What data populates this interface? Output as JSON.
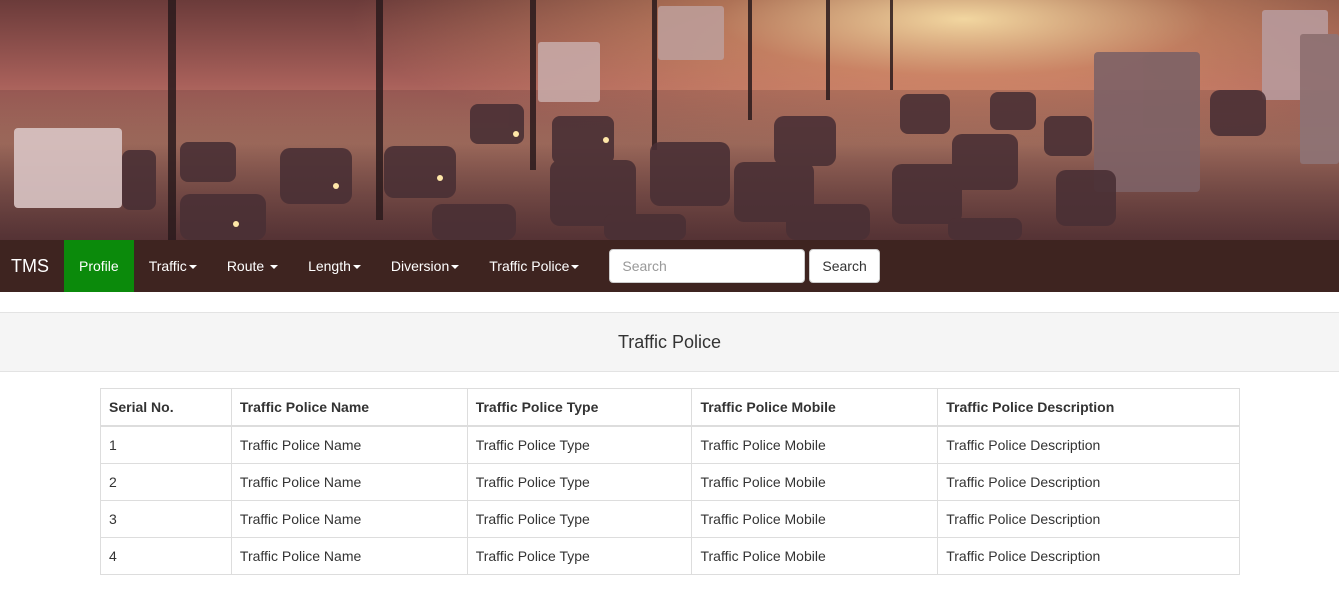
{
  "navbar": {
    "brand": "TMS",
    "items": [
      {
        "label": "Profile",
        "active": true,
        "dropdown": false
      },
      {
        "label": "Traffic",
        "active": false,
        "dropdown": true
      },
      {
        "label": "Route ",
        "active": false,
        "dropdown": true
      },
      {
        "label": "Length",
        "active": false,
        "dropdown": true
      },
      {
        "label": "Diversion",
        "active": false,
        "dropdown": true
      },
      {
        "label": "Traffic Police",
        "active": false,
        "dropdown": true
      }
    ],
    "search": {
      "placeholder": "Search",
      "value": "",
      "button_label": "Search"
    },
    "colors": {
      "navbar_bg": "#3e2420",
      "active_bg": "#0b8a0b"
    }
  },
  "panel": {
    "title": "Traffic Police"
  },
  "table": {
    "headers": [
      "Serial No.",
      "Traffic Police Name",
      "Traffic Police Type",
      "Traffic Police Mobile",
      "Traffic Police Description"
    ],
    "rows": [
      [
        "1",
        "Traffic Police Name",
        "Traffic Police Type",
        "Traffic Police Mobile",
        "Traffic Police Description"
      ],
      [
        "2",
        "Traffic Police Name",
        "Traffic Police Type",
        "Traffic Police Mobile",
        "Traffic Police Description"
      ],
      [
        "3",
        "Traffic Police Name",
        "Traffic Police Type",
        "Traffic Police Mobile",
        "Traffic Police Description"
      ],
      [
        "4",
        "Traffic Police Name",
        "Traffic Police Type",
        "Traffic Police Mobile",
        "Traffic Police Description"
      ]
    ]
  }
}
